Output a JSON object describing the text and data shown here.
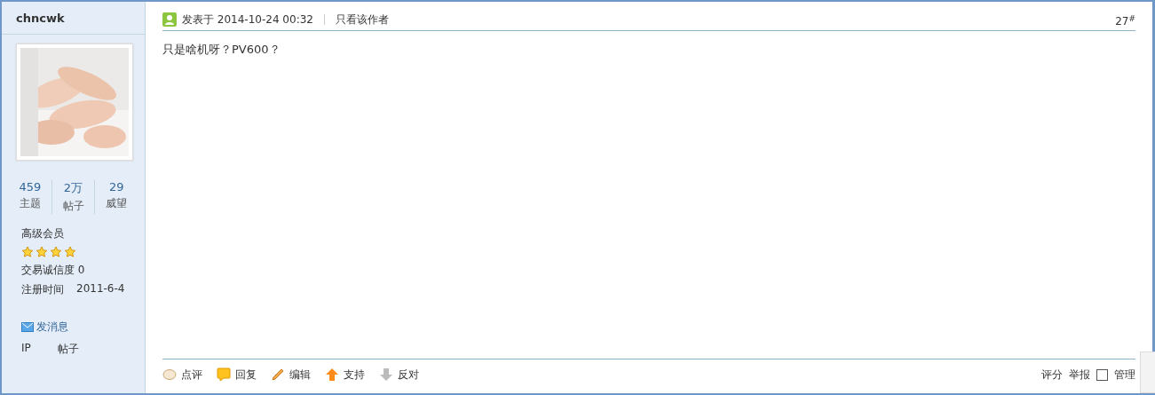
{
  "author": {
    "username": "chncwk",
    "stats": [
      {
        "value": "459",
        "label": "主题"
      },
      {
        "value": "2万",
        "label": "帖子"
      },
      {
        "value": "29",
        "label": "威望"
      }
    ],
    "rank": "高级会员",
    "stars": 4,
    "credit": "交易诚信度 0",
    "registered_label": "注册时间",
    "registered": "2011-6-4",
    "message_link": "发消息",
    "ip_label": "IP",
    "ip_posts": "帖子"
  },
  "post": {
    "posted": "发表于 2014-10-24 00:32",
    "author_only": "只看该作者",
    "floor": "27",
    "floor_mark": "#",
    "content": "只是啥机呀？PV600？"
  },
  "actions": [
    {
      "kind": "comment",
      "label": "点评"
    },
    {
      "kind": "reply",
      "label": "回复"
    },
    {
      "kind": "edit",
      "label": "编辑"
    },
    {
      "kind": "up",
      "label": "支持"
    },
    {
      "kind": "down",
      "label": "反对"
    }
  ],
  "tools": [
    {
      "kind": "link",
      "label": "评分"
    },
    {
      "kind": "link",
      "label": "举报"
    },
    {
      "kind": "check",
      "label": "管理",
      "checked": false
    }
  ]
}
